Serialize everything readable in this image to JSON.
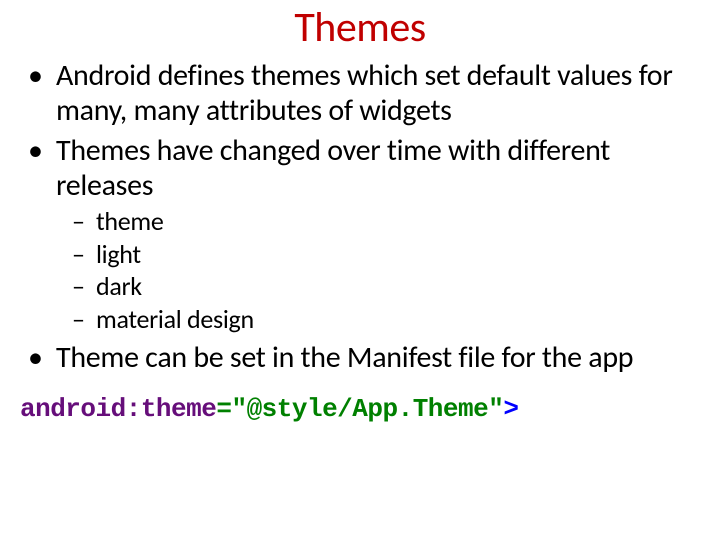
{
  "title": "Themes",
  "bullets": {
    "b1": "Android defines themes which set default values for many, many attributes of widgets",
    "b2": "Themes have changed over time with different releases",
    "sub": {
      "s1": "theme",
      "s2": "light",
      "s3": "dark",
      "s4": "material design"
    },
    "b3": "Theme can be set in the Manifest file for the app"
  },
  "code": {
    "attr": "android:theme",
    "eq": "=",
    "q1": "\"",
    "value": "@style/App.Theme",
    "q2": "\"",
    "gt": ">"
  }
}
